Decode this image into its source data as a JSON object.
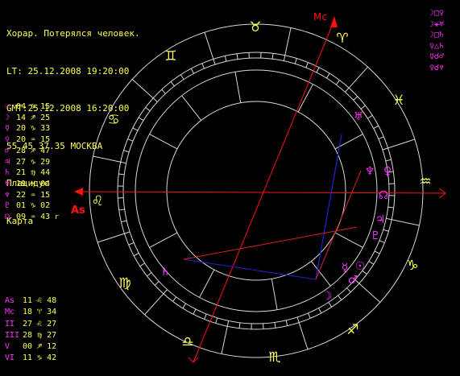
{
  "colors": {
    "bg": "#000000",
    "header": "#ffff55",
    "zodiac": "#ffff55",
    "planet": "#ff33ff",
    "axis": "#ff1111",
    "aspect_red": "#dd2222",
    "aspect_blue": "#2222dd",
    "ring": "#d8d8d8"
  },
  "header": {
    "line1": "Хорар. Потерялся человек.",
    "line2": "LT: 25.12.2008 19:20:00",
    "line3": "GMT:25.12.2008 16:20:00",
    "line4": "55.45 37.35 МОСКВА",
    "line5": "Плацидус",
    "line6": "Карта"
  },
  "planets": [
    {
      "glyph": "☉",
      "pos": "04 ♑ 15"
    },
    {
      "glyph": "☽",
      "pos": "14 ♐ 25"
    },
    {
      "glyph": "☿",
      "pos": "20 ♑ 33"
    },
    {
      "glyph": "♀",
      "pos": "20 ♒ 15"
    },
    {
      "glyph": "♂",
      "pos": "28 ♐ 47"
    },
    {
      "glyph": "♃",
      "pos": "27 ♑ 29"
    },
    {
      "glyph": "♄",
      "pos": "21 ♍ 44"
    },
    {
      "glyph": "♅",
      "pos": "19 ♓ 04"
    },
    {
      "glyph": "♆",
      "pos": "22 ♒ 15"
    },
    {
      "glyph": "♇",
      "pos": "01 ♑ 02"
    },
    {
      "glyph": "☊",
      "pos": "09 ♒ 43",
      "suffix": "r"
    }
  ],
  "cusps": [
    {
      "label": "As",
      "pos": "11 ♌ 48"
    },
    {
      "label": "Mc",
      "pos": "18 ♈ 34"
    },
    {
      "label": "II",
      "pos": "27 ♌ 27"
    },
    {
      "label": "III",
      "pos": "28 ♍ 27"
    },
    {
      "label": "V",
      "pos": "00 ♐ 12"
    },
    {
      "label": "VI",
      "pos": "11 ♑ 42"
    }
  ],
  "aspects": [
    {
      "text": "☽□♀"
    },
    {
      "text": "☽⚹♅"
    },
    {
      "text": "☽□♄"
    },
    {
      "text": "♀△♄"
    },
    {
      "text": "☿☌♂"
    },
    {
      "text": "♀☌♆"
    }
  ],
  "chart": {
    "as_label": "As",
    "mc_label": "Mc",
    "signs": [
      {
        "name": "aries-icon",
        "glyph": "♈"
      },
      {
        "name": "taurus-icon",
        "glyph": "♉"
      },
      {
        "name": "gemini-icon",
        "glyph": "♊"
      },
      {
        "name": "cancer-icon",
        "glyph": "♋"
      },
      {
        "name": "leo-icon",
        "glyph": "♌"
      },
      {
        "name": "virgo-icon",
        "glyph": "♍"
      },
      {
        "name": "libra-icon",
        "glyph": "♎"
      },
      {
        "name": "scorpio-icon",
        "glyph": "♏"
      },
      {
        "name": "sagittarius-icon",
        "glyph": "♐"
      },
      {
        "name": "capricorn-icon",
        "glyph": "♑"
      },
      {
        "name": "aquarius-icon",
        "glyph": "♒"
      },
      {
        "name": "pisces-icon",
        "glyph": "♓"
      }
    ],
    "planet_marks": [
      {
        "name": "uranus-icon",
        "glyph": "♅"
      },
      {
        "name": "neptune-icon",
        "glyph": "♆"
      },
      {
        "name": "venus-icon",
        "glyph": "♀"
      },
      {
        "name": "north-node-icon",
        "glyph": "☊"
      },
      {
        "name": "jupiter-icon",
        "glyph": "♃"
      },
      {
        "name": "pluto-icon",
        "glyph": "♇"
      },
      {
        "name": "mercury-icon",
        "glyph": "☿"
      },
      {
        "name": "sun-icon",
        "glyph": "☉"
      },
      {
        "name": "mars-icon",
        "glyph": "♂"
      },
      {
        "name": "moon-icon",
        "glyph": "☽"
      },
      {
        "name": "saturn-icon",
        "glyph": "♄"
      }
    ]
  }
}
